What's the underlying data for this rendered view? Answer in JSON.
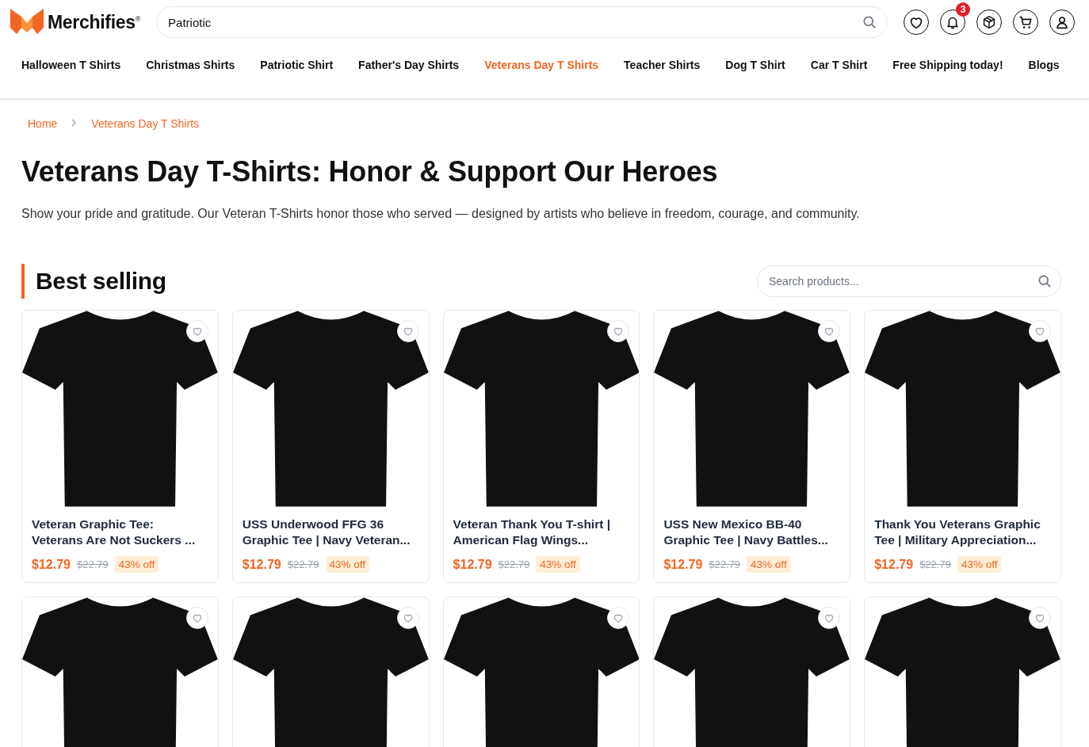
{
  "header": {
    "logo": "Merchifies$^{®}$",
    "search": {
      "value": "Patriotic"
    },
    "notification_count": "3"
  },
  "nav": [
    {
      "label": "Halloween T Shirts",
      "selected": false
    },
    {
      "label": "Christmas Shirts",
      "selected": false
    },
    {
      "label": "Patriotic Shirt",
      "selected": false
    },
    {
      "label": "Father's Day Shirts",
      "selected": false
    },
    {
      "label": "Veterans Day T Shirts",
      "selected": true
    },
    {
      "label": "Teacher Shirts",
      "selected": false
    },
    {
      "label": "Dog T Shirt",
      "selected": false
    },
    {
      "label": "Car T Shirt",
      "selected": false
    },
    {
      "label": "Free Shipping today!",
      "selected": false
    },
    {
      "label": "Blogs",
      "selected": false
    }
  ],
  "breadcrumb": [
    "Home",
    "Veterans Day T Shirts"
  ],
  "title": "Veterans Day T-Shirts: Honor & Support Our Heroes",
  "description": "Show your pride and gratitude. Our Veteran T-Shirts honor those who served — designed by artists who believe in freedom, courage, and community.",
  "section": {
    "heading": "Best selling",
    "search": {
      "placeholder": "Search products..."
    }
  },
  "products": [
    {
      "title": "Veteran Graphic Tee: Veterans Are Not Suckers ...",
      "price": "$12.79",
      "old_price": "$22.79",
      "discount": "43% off",
      "favorited": false
    },
    {
      "title": "USS Underwood FFG 36 Graphic Tee | Navy Veteran...",
      "price": "$12.79",
      "old_price": "$22.79",
      "discount": "43% off",
      "favorited": false
    },
    {
      "title": "Veteran Thank You T-shirt | American Flag Wings...",
      "price": "$12.79",
      "old_price": "$22.79",
      "discount": "43% off",
      "favorited": false
    },
    {
      "title": "USS New Mexico BB-40 Graphic Tee | Navy Battles...",
      "price": "$12.79",
      "old_price": "$22.79",
      "discount": "43% off",
      "favorited": false
    },
    {
      "title": "Thank You Veterans Graphic Tee | Military Appreciation...",
      "price": "$12.79",
      "old_price": "$22.79",
      "discount": "43% off",
      "favorited": false
    },
    {
      "favorited": false
    },
    {
      "favorited": false
    },
    {
      "favorited": false
    },
    {
      "favorited": false
    },
    {
      "favorited": false
    }
  ]
}
